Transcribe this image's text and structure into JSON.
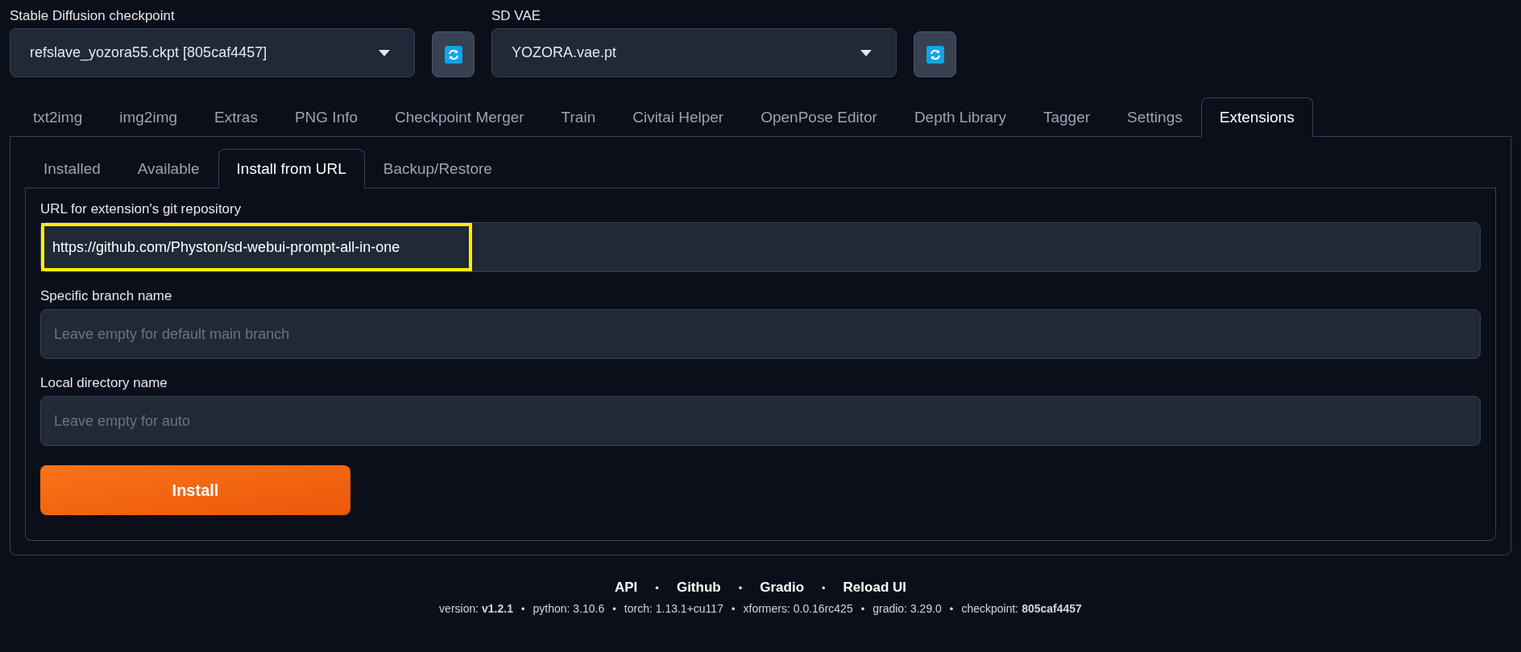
{
  "model_selectors": [
    {
      "label": "Stable Diffusion checkpoint",
      "value": "refslave_yozora55.ckpt [805caf4457]"
    },
    {
      "label": "SD VAE",
      "value": "YOZORA.vae.pt"
    }
  ],
  "main_tabs": [
    {
      "label": "txt2img",
      "selected": false
    },
    {
      "label": "img2img",
      "selected": false
    },
    {
      "label": "Extras",
      "selected": false
    },
    {
      "label": "PNG Info",
      "selected": false
    },
    {
      "label": "Checkpoint Merger",
      "selected": false
    },
    {
      "label": "Train",
      "selected": false
    },
    {
      "label": "Civitai Helper",
      "selected": false
    },
    {
      "label": "OpenPose Editor",
      "selected": false
    },
    {
      "label": "Depth Library",
      "selected": false
    },
    {
      "label": "Tagger",
      "selected": false
    },
    {
      "label": "Settings",
      "selected": false
    },
    {
      "label": "Extensions",
      "selected": true
    }
  ],
  "sub_tabs": [
    {
      "label": "Installed",
      "selected": false
    },
    {
      "label": "Available",
      "selected": false
    },
    {
      "label": "Install from URL",
      "selected": true
    },
    {
      "label": "Backup/Restore",
      "selected": false
    }
  ],
  "fields": [
    {
      "label": "URL for extension's git repository",
      "value": "https://github.com/Physton/sd-webui-prompt-all-in-one",
      "highlighted": true
    },
    {
      "label": "Specific branch name",
      "placeholder": "Leave empty for default main branch",
      "highlighted": false
    },
    {
      "label": "Local directory name",
      "placeholder": "Leave empty for auto",
      "highlighted": false
    }
  ],
  "install_button": "Install",
  "footer": {
    "links": [
      {
        "kind": "link",
        "text": "API"
      },
      {
        "kind": "separator",
        "text": "•"
      },
      {
        "kind": "link",
        "text": "Github"
      },
      {
        "kind": "separator",
        "text": "•"
      },
      {
        "kind": "link",
        "text": "Gradio"
      },
      {
        "kind": "separator",
        "text": "•"
      },
      {
        "kind": "link",
        "text": "Reload UI"
      }
    ],
    "versions": [
      {
        "kind": "info",
        "text": "version: **v1.2.1**"
      },
      {
        "kind": "separator",
        "text": "•"
      },
      {
        "kind": "info",
        "text": "python: 3.10.6"
      },
      {
        "kind": "separator",
        "text": "•"
      },
      {
        "kind": "info",
        "text": "torch: 1.13.1+cu117"
      },
      {
        "kind": "separator",
        "text": "•"
      },
      {
        "kind": "info",
        "text": "xformers: 0.0.16rc425"
      },
      {
        "kind": "separator",
        "text": "•"
      },
      {
        "kind": "info",
        "text": "gradio: 3.29.0"
      },
      {
        "kind": "separator",
        "text": "•"
      },
      {
        "kind": "info",
        "text": "checkpoint: **805caf4457**"
      }
    ]
  }
}
